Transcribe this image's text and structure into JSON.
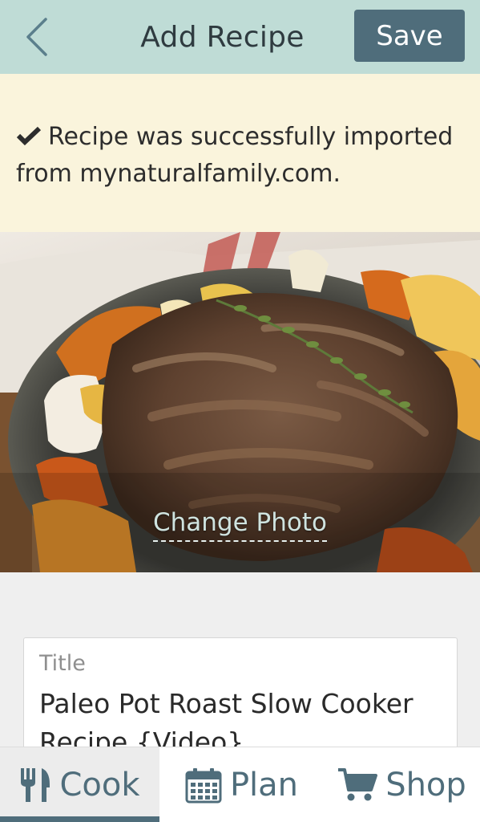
{
  "header": {
    "title": "Add Recipe",
    "save_label": "Save",
    "back_icon": "chevron-left-icon"
  },
  "banner": {
    "icon": "check-icon",
    "message": "Recipe was successfully imported from mynaturalfamily.com."
  },
  "photo": {
    "description_icon": "recipe-photo",
    "change_label": "Change Photo"
  },
  "form": {
    "title_label": "Title",
    "title_value": "Paleo Pot Roast Slow Cooker Recipe {Video}"
  },
  "nav": {
    "tabs": [
      {
        "label": "Cook",
        "icon": "utensils-icon",
        "active": true
      },
      {
        "label": "Plan",
        "icon": "calendar-icon",
        "active": false
      },
      {
        "label": "Shop",
        "icon": "cart-icon",
        "active": false
      }
    ]
  },
  "colors": {
    "header_bg": "#bfdcd6",
    "accent": "#4f6d7b",
    "banner_bg": "#faf4dc",
    "page_bg": "#efefef"
  }
}
